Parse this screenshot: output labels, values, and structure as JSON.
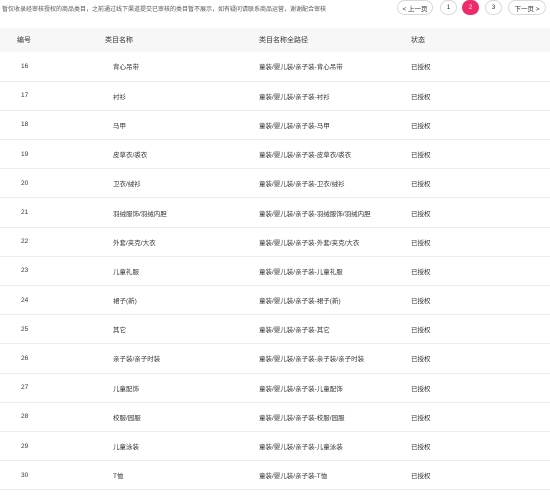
{
  "notice": "暂仅收录经审核授权的商品类目，之前通过线下渠道提交已审核的类目暂不展示，如有疑问请联系商品运营，谢谢配合审核",
  "table": {
    "headers": [
      "编号",
      "类目名称",
      "类目名称全路径",
      "状态"
    ],
    "rows": [
      {
        "id": "16",
        "name": "背心吊带",
        "path": "童装/婴儿装/亲子装-背心吊带",
        "status": "已授权"
      },
      {
        "id": "17",
        "name": "衬衫",
        "path": "童装/婴儿装/亲子装-衬衫",
        "status": "已授权"
      },
      {
        "id": "18",
        "name": "马甲",
        "path": "童装/婴儿装/亲子装-马甲",
        "status": "已授权"
      },
      {
        "id": "19",
        "name": "皮草衣/裘衣",
        "path": "童装/婴儿装/亲子装-皮草衣/裘衣",
        "status": "已授权"
      },
      {
        "id": "20",
        "name": "卫衣/绒衫",
        "path": "童装/婴儿装/亲子装-卫衣/绒衫",
        "status": "已授权"
      },
      {
        "id": "21",
        "name": "羽绒服饰/羽绒内胆",
        "path": "童装/婴儿装/亲子装-羽绒服饰/羽绒内胆",
        "status": "已授权"
      },
      {
        "id": "22",
        "name": "外套/夹克/大衣",
        "path": "童装/婴儿装/亲子装-外套/夹克/大衣",
        "status": "已授权"
      },
      {
        "id": "23",
        "name": "儿童礼服",
        "path": "童装/婴儿装/亲子装-儿童礼服",
        "status": "已授权"
      },
      {
        "id": "24",
        "name": "裙子(新)",
        "path": "童装/婴儿装/亲子装-裙子(新)",
        "status": "已授权"
      },
      {
        "id": "25",
        "name": "其它",
        "path": "童装/婴儿装/亲子装-其它",
        "status": "已授权"
      },
      {
        "id": "26",
        "name": "亲子装/亲子时装",
        "path": "童装/婴儿装/亲子装-亲子装/亲子时装",
        "status": "已授权"
      },
      {
        "id": "27",
        "name": "儿童配饰",
        "path": "童装/婴儿装/亲子装-儿童配饰",
        "status": "已授权"
      },
      {
        "id": "28",
        "name": "校服/园服",
        "path": "童装/婴儿装/亲子装-校服/园服",
        "status": "已授权"
      },
      {
        "id": "29",
        "name": "儿童泳装",
        "path": "童装/婴儿装/亲子装-儿童泳装",
        "status": "已授权"
      },
      {
        "id": "30",
        "name": "T恤",
        "path": "童装/婴儿装/亲子装-T恤",
        "status": "已授权"
      }
    ]
  },
  "pagination": {
    "prev_label": "< 上一页",
    "next_label": "下一页 >",
    "pages": [
      "1",
      "2",
      "3"
    ],
    "current": "2"
  },
  "colors": {
    "accent": "#ee2a6b",
    "header_bg": "#f7f7f7"
  }
}
